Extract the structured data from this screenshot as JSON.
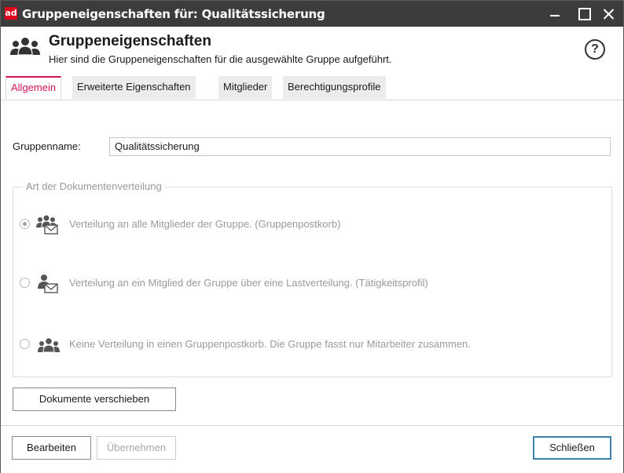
{
  "window": {
    "app_icon": "ad",
    "title": "Gruppeneigenschaften für: Qualitätssicherung"
  },
  "header": {
    "title": "Gruppeneigenschaften",
    "subtitle": "Hier sind die Gruppeneigenschaften für die ausgewählte Gruppe aufgeführt.",
    "help": "?"
  },
  "tabs": [
    {
      "label": "Allgemein",
      "active": true
    },
    {
      "label": "Erweiterte Eigenschaften",
      "active": false
    },
    {
      "label": "Mitglieder",
      "active": false
    },
    {
      "label": "Berechtigungsprofile",
      "active": false
    }
  ],
  "form": {
    "group_name_label": "Gruppenname:",
    "group_name_value": "Qualitätssicherung"
  },
  "distribution": {
    "title": "Art der Dokumentenverteilung",
    "options": [
      {
        "label": "Verteilung an alle Mitglieder der Gruppe. (Gruppenpostkorb)",
        "checked": true,
        "icon": "group-mail-icon"
      },
      {
        "label": "Verteilung an ein Mitglied der Gruppe über eine Lastverteilung. (Tätigkeitsprofil)",
        "checked": false,
        "icon": "user-mail-icon"
      },
      {
        "label": "Keine Verteilung in einen Gruppenpostkorb. Die Gruppe fasst nur Mitarbeiter zusammen.",
        "checked": false,
        "icon": "group-icon"
      }
    ]
  },
  "buttons": {
    "move_documents": "Dokumente verschieben",
    "edit": "Bearbeiten",
    "apply": "Übernehmen",
    "close": "Schließen"
  },
  "colors": {
    "accent": "#d4145a",
    "titlebar": "#3c3c3c",
    "brand": "#e3001b"
  }
}
